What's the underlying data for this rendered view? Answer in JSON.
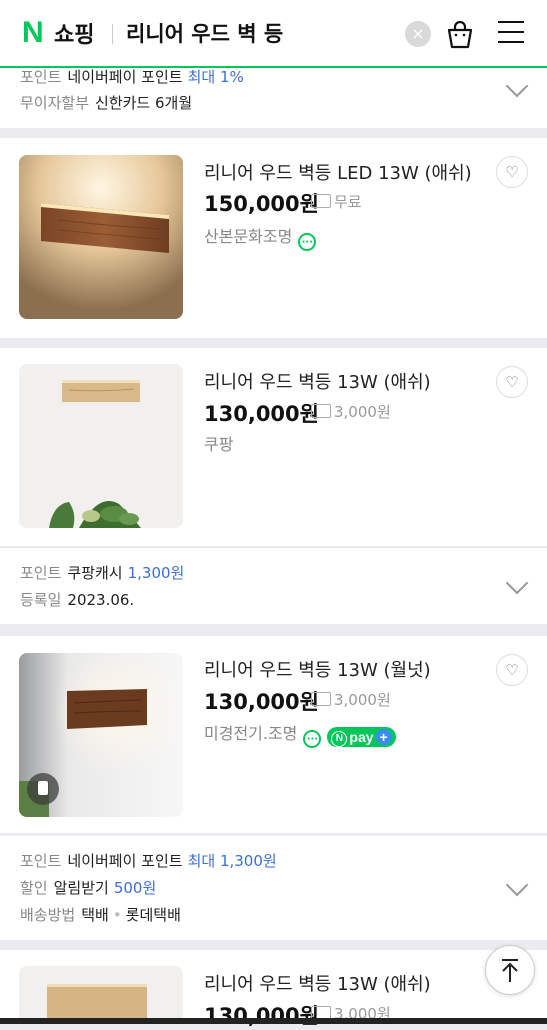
{
  "header": {
    "logo_mark": "N",
    "logo_text": "쇼핑",
    "query": "리니어 우드 벽 등",
    "clear_label": "×",
    "accent_color": "#03c75a"
  },
  "top_info": {
    "line1": {
      "k": "포인트",
      "v": "네이버페이 포인트",
      "b": "최대 1%"
    },
    "line2": {
      "k": "무이자할부",
      "v": "신한카드 6개월"
    }
  },
  "products": [
    {
      "title": "리니어 우드 벽등 LED 13W (애쉬)",
      "price": "150,000원",
      "shipping": "무료",
      "seller": "산본문화조명",
      "talk_icon": "talk-icon"
    },
    {
      "title": "리니어 우드 벽등 13W (애쉬)",
      "price": "130,000원",
      "shipping": "3,000원",
      "seller": "쿠팡"
    },
    {
      "title": "리니어 우드 벽등 13W (월넛)",
      "price": "130,000원",
      "shipping": "3,000원",
      "seller": "미경전기.조명",
      "npay": "pay"
    },
    {
      "title": "리니어 우드 벽등 13W (애쉬)",
      "price": "130,000원",
      "shipping": "3,000원"
    }
  ],
  "info2": {
    "line1": {
      "k": "포인트",
      "v": "쿠팡캐시",
      "b": "1,300원"
    },
    "line2": {
      "k": "등록일",
      "v": "2023.06."
    }
  },
  "info3": {
    "line1": {
      "k": "포인트",
      "v": "네이버페이 포인트",
      "b": "최대 1,300원"
    },
    "line2": {
      "k": "할인",
      "v": "알림받기",
      "b": "500원"
    },
    "line3": {
      "k": "배송방법",
      "v": "택배",
      "v2": "롯데택배"
    }
  }
}
